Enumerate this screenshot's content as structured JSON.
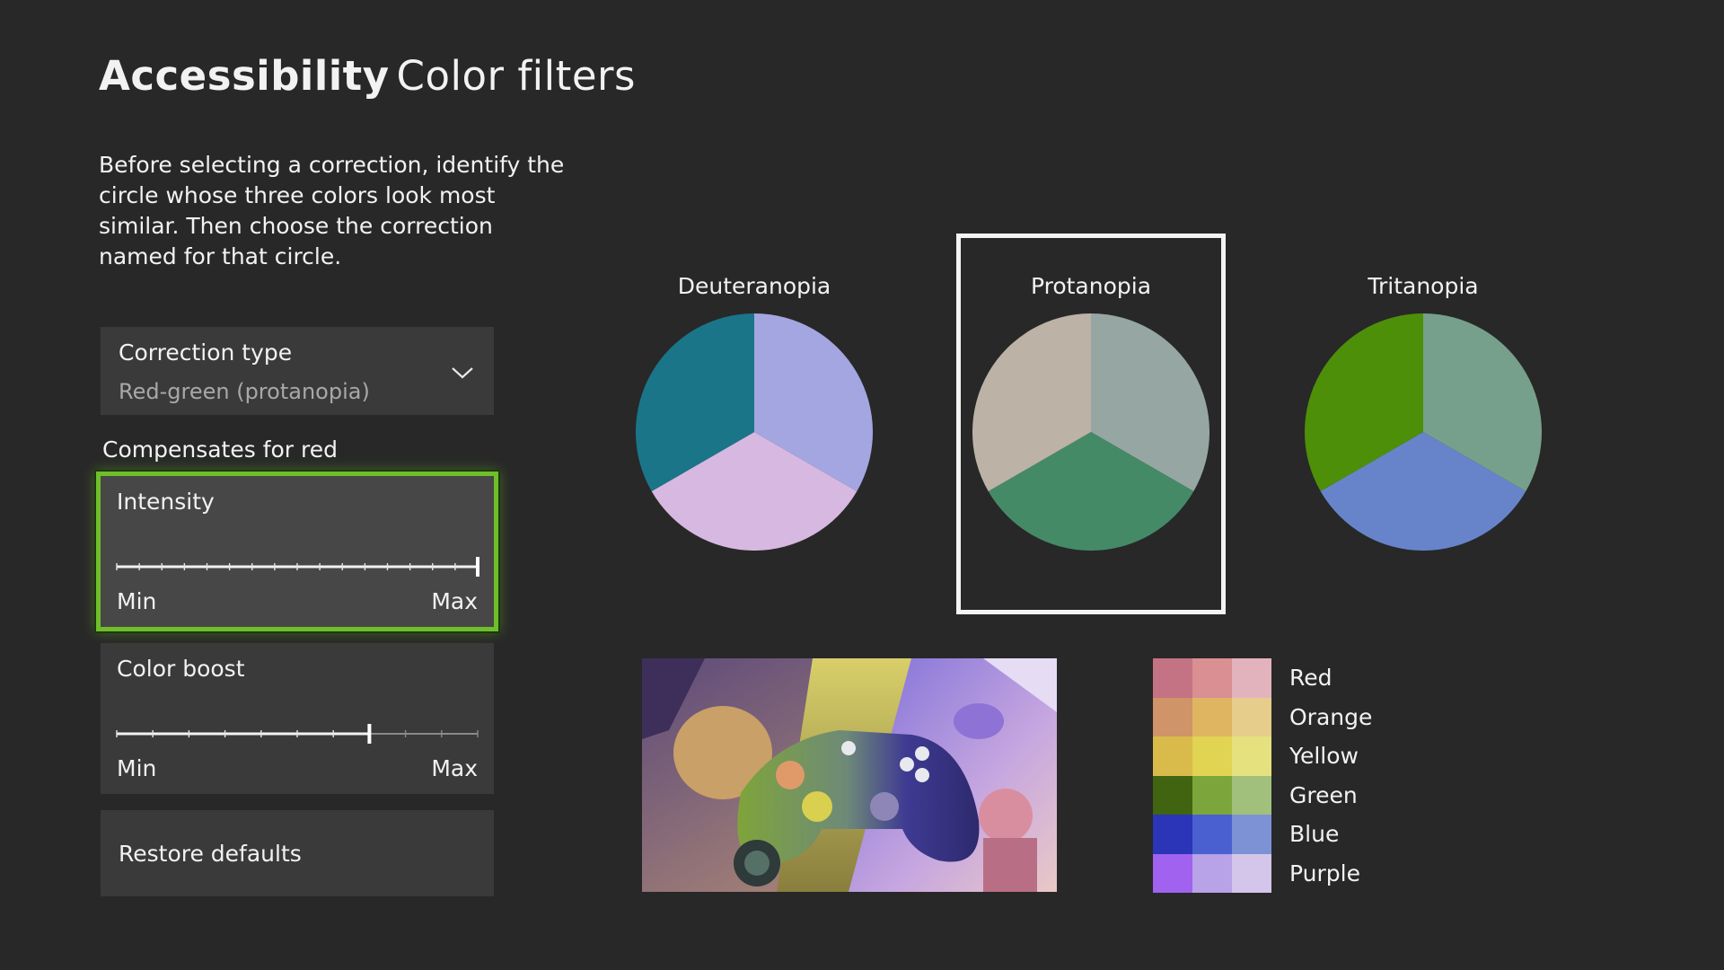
{
  "header": {
    "title_bold": "Accessibility",
    "title_light": "Color filters"
  },
  "description": "Before selecting a correction, identify the circle whose three colors look most similar. Then choose the correction named for that circle.",
  "correction": {
    "label": "Correction type",
    "value": "Red-green (protanopia)",
    "icon": "chevron-down-icon"
  },
  "compensates_label": "Compensates for red",
  "intensity": {
    "label": "Intensity",
    "min_label": "Min",
    "max_label": "Max",
    "value": 1.0,
    "ticks": 16,
    "focused": true
  },
  "color_boost": {
    "label": "Color boost",
    "min_label": "Min",
    "max_label": "Max",
    "value": 0.7,
    "ticks": 10
  },
  "restore_label": "Restore defaults",
  "circles": [
    {
      "label": "Deuteranopia",
      "colors": [
        "#a3a6e0",
        "#d6b8e1",
        "#1a7589"
      ],
      "selected": false
    },
    {
      "label": "Protanopia",
      "colors": [
        "#96a7a3",
        "#458a66",
        "#bcb2a6"
      ],
      "selected": true
    },
    {
      "label": "Tritanopia",
      "colors": [
        "#76a08b",
        "#6784cb",
        "#4e8f0a"
      ],
      "selected": false
    }
  ],
  "swatches": [
    {
      "label": "Red",
      "colors": [
        "#c47384",
        "#da8f92",
        "#e3b3bd"
      ]
    },
    {
      "label": "Orange",
      "colors": [
        "#cf9468",
        "#e0b562",
        "#e7cd8c"
      ]
    },
    {
      "label": "Yellow",
      "colors": [
        "#d9bb4c",
        "#e2d453",
        "#e5e17e"
      ]
    },
    {
      "label": "Green",
      "colors": [
        "#40640f",
        "#7ca63b",
        "#a0c07c"
      ]
    },
    {
      "label": "Blue",
      "colors": [
        "#2a35b7",
        "#4a60d0",
        "#7d92d4"
      ]
    },
    {
      "label": "Purple",
      "colors": [
        "#a162ef",
        "#b8a2e8",
        "#d4c5ea"
      ]
    }
  ],
  "colors": {
    "background": "#282828",
    "panel": "#3a3a3a",
    "focus": "#6fbf2a",
    "text": "#f2f2f2",
    "muted": "#a8a8a8"
  }
}
